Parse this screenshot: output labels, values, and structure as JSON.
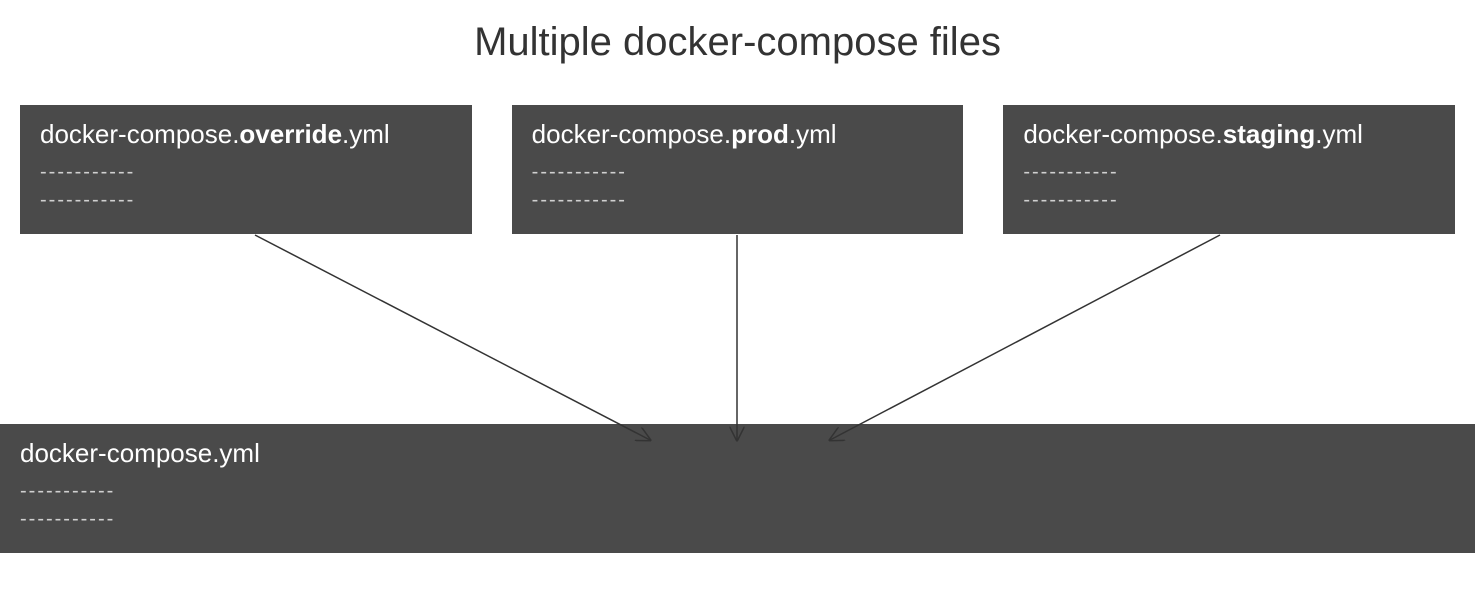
{
  "title": "Multiple docker-compose files",
  "topFiles": [
    {
      "prefix": "docker-compose.",
      "bold": "override",
      "suffix": ".yml",
      "line1": "-----------",
      "line2": "-----------"
    },
    {
      "prefix": "docker-compose.",
      "bold": "prod",
      "suffix": ".yml",
      "line1": "-----------",
      "line2": "-----------"
    },
    {
      "prefix": "docker-compose.",
      "bold": "staging",
      "suffix": ".yml",
      "line1": "-----------",
      "line2": "-----------"
    }
  ],
  "bottomFile": {
    "name": "docker-compose.yml",
    "line1": "-----------",
    "line2": "-----------"
  }
}
